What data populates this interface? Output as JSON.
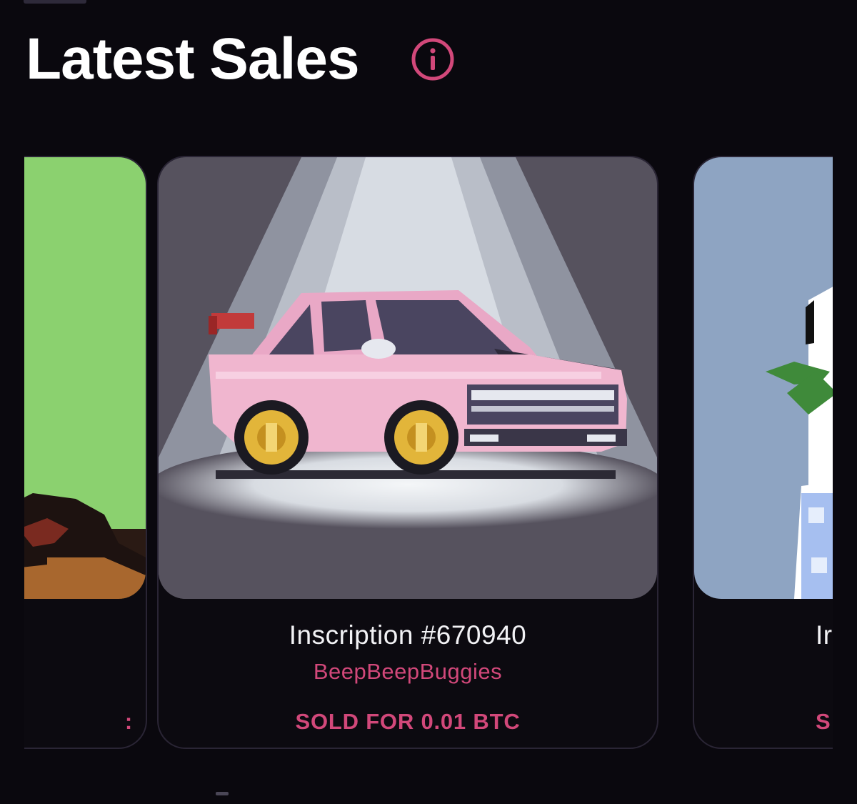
{
  "header": {
    "title": "Latest Sales"
  },
  "sales": {
    "left_card": {
      "price_fragment": ":"
    },
    "center_card": {
      "title": "Inscription #670940",
      "collection": "BeepBeepBuggies",
      "price": "SOLD FOR 0.01 BTC"
    },
    "right_card": {
      "title_fragment": "Ir",
      "price_fragment": "S"
    }
  },
  "colors": {
    "background": "#0a080e",
    "accent": "#d2487a",
    "text": "#ffffff"
  },
  "icons": {
    "info": "info-circle-icon"
  }
}
